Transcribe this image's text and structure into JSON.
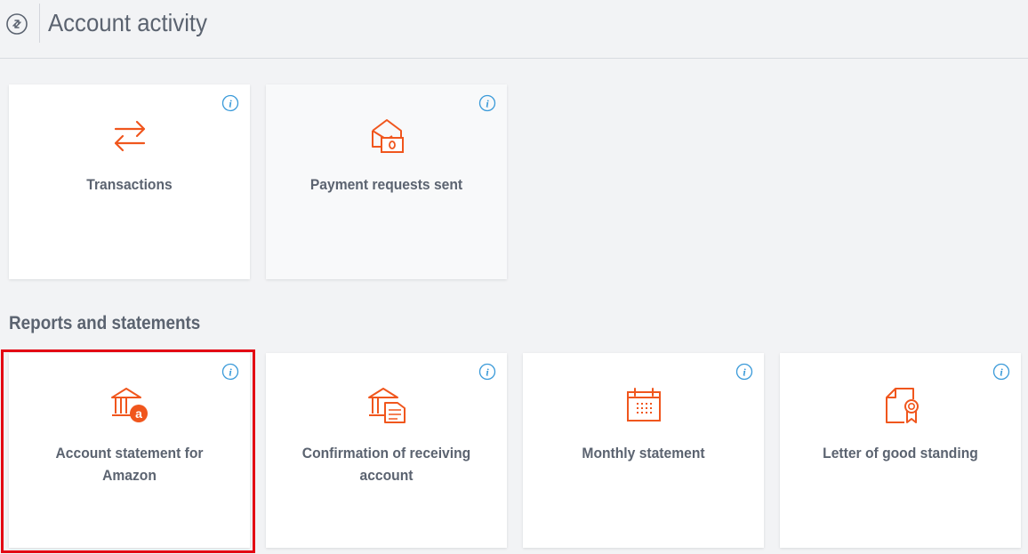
{
  "header": {
    "title": "Account activity",
    "icon": "account-activity-icon"
  },
  "account_activity": {
    "cards": [
      {
        "label": "Transactions",
        "icon": "transfer-arrows-icon"
      },
      {
        "label": "Payment requests sent",
        "icon": "envelope-money-icon"
      }
    ]
  },
  "reports": {
    "section_title": "Reports and statements",
    "cards": [
      {
        "label": "Account statement for Amazon",
        "icon": "bank-amazon-icon",
        "selected": true
      },
      {
        "label": "Confirmation of receiving account",
        "icon": "bank-document-icon"
      },
      {
        "label": "Monthly statement",
        "icon": "calendar-icon"
      },
      {
        "label": "Letter of good standing",
        "icon": "certificate-icon"
      }
    ]
  },
  "colors": {
    "accent": "#f0561d",
    "info": "#3a9ad9",
    "text": "#5b6370",
    "selection": "#e30613"
  }
}
